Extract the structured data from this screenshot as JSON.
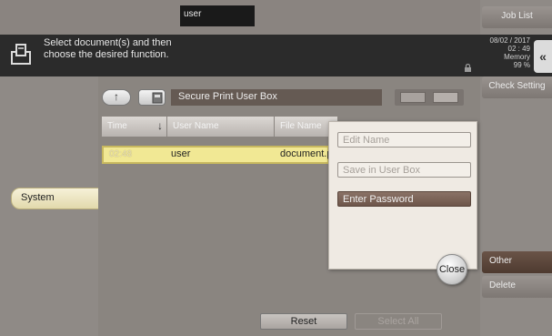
{
  "header": {
    "user": "user",
    "message_line1": "Select document(s) and then",
    "message_line2": "choose the desired function."
  },
  "status": {
    "date": "08/02 / 2017",
    "time": "02 : 49",
    "memory_label": "Memory",
    "memory_value": "99 %"
  },
  "right_panel": {
    "job_list": "Job List",
    "check_setting": "Check Setting",
    "other": "Other",
    "delete": "Delete"
  },
  "left_panel": {
    "system": "System"
  },
  "box": {
    "title": "Secure Print User Box"
  },
  "table": {
    "headers": [
      "Time",
      "User Name",
      "File Name"
    ],
    "rows": [
      {
        "time": "02:48",
        "user": "user",
        "file": "document.p"
      }
    ]
  },
  "footer": {
    "reset": "Reset",
    "select_all": "Select All"
  },
  "popup": {
    "items": [
      "Edit Name",
      "Save in User Box",
      "Enter Password"
    ],
    "close": "Close"
  },
  "colors": {
    "accent": "#6d554a",
    "highlight": "#f1e894",
    "background": "#8f8a86"
  }
}
